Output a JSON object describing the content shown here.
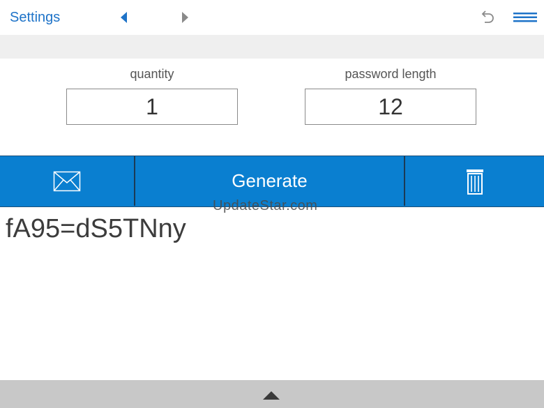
{
  "topbar": {
    "settings_label": "Settings",
    "prev_icon": "caret-left-icon",
    "next_icon": "caret-right-icon",
    "undo_icon": "undo-icon",
    "menu_icon": "hamburger-menu-icon"
  },
  "fields": {
    "quantity_label": "quantity",
    "quantity_value": "1",
    "length_label": "password length",
    "length_value": "12"
  },
  "actions": {
    "email_icon": "envelope-icon",
    "generate_label": "Generate",
    "delete_icon": "trash-icon"
  },
  "output": {
    "password": "fA95=dS5TNny"
  },
  "watermark": "UpdateStar.com",
  "bottombar": {
    "expand_icon": "triangle-up-icon"
  },
  "colors": {
    "accent": "#1e73c8",
    "action_bar": "#0a7fd0",
    "action_divider": "#1b3a55"
  }
}
